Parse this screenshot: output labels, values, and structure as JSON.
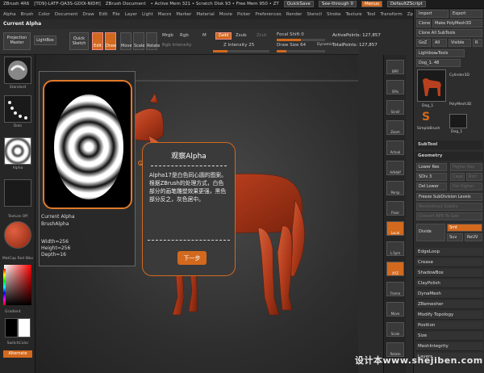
{
  "titlebar": {
    "app": "ZBrush 4R6",
    "doc_info": "[TD9]-LATF-QA3S-GDOI-NIDH]",
    "doc": "ZBrush Document",
    "active_mem": "• Active Mem 321 • Scratch Disk 93 • Free Mem 950 • ZT",
    "quicksave": "QuickSave",
    "seethrough": "See-through 0",
    "menus": "Menus",
    "script": "DefaultZScript"
  },
  "menubar": [
    "Alpha",
    "Brush",
    "Color",
    "Document",
    "Draw",
    "Edit",
    "File",
    "Layer",
    "Light",
    "Macro",
    "Marker",
    "Material",
    "Movie",
    "Picker",
    "Preferences",
    "Render",
    "Stencil",
    "Stroke",
    "Texture",
    "Tool",
    "Transform",
    "Zplugin",
    "Zscript"
  ],
  "palette_label": "Current Alpha",
  "shelf": {
    "projection_master": "Projection Master",
    "lightbox": "LightBox",
    "quick_sketch": "Quick Sketch",
    "edit": "Edit",
    "draw": "Draw",
    "move": "Move",
    "scale": "Scale",
    "rotate": "Rotate",
    "mrgb": "Mrgb",
    "rgb": "Rgb",
    "m": "M",
    "zadd": "Zadd",
    "zsub": "Zsub",
    "zcut": "Zcut",
    "rgb_intensity": "Rgb Intensity",
    "z_intensity": "Z Intensity 25",
    "focal_shift": "Focal Shift 0",
    "draw_size": "Draw Size 64",
    "dynamic": "Dynamic",
    "active_points": "ActivePoints: 127,857",
    "total_points": "TotalPoints: 127,857"
  },
  "left_panel": {
    "standard": "Standard",
    "dots": "Dots",
    "alpha": "Alpha",
    "texture_off": "Texture Off",
    "matcap": "MatCap Red Wax",
    "gradient": "Gradient",
    "switchcolor": "SwitchColor",
    "alternate": "Alternate"
  },
  "alpha_popup": {
    "title": "Current Alpha",
    "name": "BrushAlpha",
    "width": "Width=256",
    "height": "Height=256",
    "depth": "Depth=16"
  },
  "tip": {
    "title": "观察Alpha",
    "body": "Alpha17是白色同心圆的图案。根据ZBrush的处理方式，白色部分的画笔雕塑效果更强，黑色部分反之，灰色居中。",
    "next": "下一步"
  },
  "right_strip": [
    "BPR",
    "SPix",
    "Scroll",
    "Zoom",
    "Actual",
    "AAHalf",
    "Persp",
    "Floor",
    "Local",
    "L.Sym",
    "XYZ",
    "Frame",
    "Move",
    "Scale",
    "Rotate"
  ],
  "tool_panel": {
    "import": "Import",
    "export": "Export",
    "clone": "Clone",
    "make_polymesh": "Make PolyMesh3D",
    "clone_all": "Clone All SubTools",
    "goz": "GoZ",
    "all": "All",
    "visible": "Visible",
    "r": "R",
    "lightbox_tools": "Lightbox▸Tools",
    "tool_name": "Dog_1. 48",
    "t1": "Dog_1",
    "t2": "Cylinder3D",
    "t3": "PolyMesh3D",
    "t4": "SimpleBrush",
    "t5": "Dog_1",
    "subtool": "SubTool",
    "geometry": "Geometry",
    "lower_res": "Lower Res",
    "higher_res": "Higher Res",
    "sdiv": "SDiv 3",
    "cage": "Cage",
    "rstr": "Rstr",
    "del_lower": "Del Lower",
    "del_higher": "Del Higher",
    "freeze": "Freeze SubDivision Levels",
    "reconstruct": "Reconstruct Subdiv",
    "convert": "Convert BPR To Geo",
    "divide": "Divide",
    "smt": "Smt",
    "suv": "Suv",
    "reuv": "ReUV",
    "rows": [
      "EdgeLoop",
      "Crease",
      "ShadowBox",
      "ClayPolish",
      "DynaMesh",
      "ZRemesher",
      "Modify Topology",
      "Position",
      "Size",
      "MeshIntegrity",
      "Layers"
    ]
  },
  "watermark": "设计本www.shejiben.com",
  "colors": {
    "accent": "#d2691e",
    "dog": "#b8401f",
    "bg": "#2b2b2b"
  }
}
